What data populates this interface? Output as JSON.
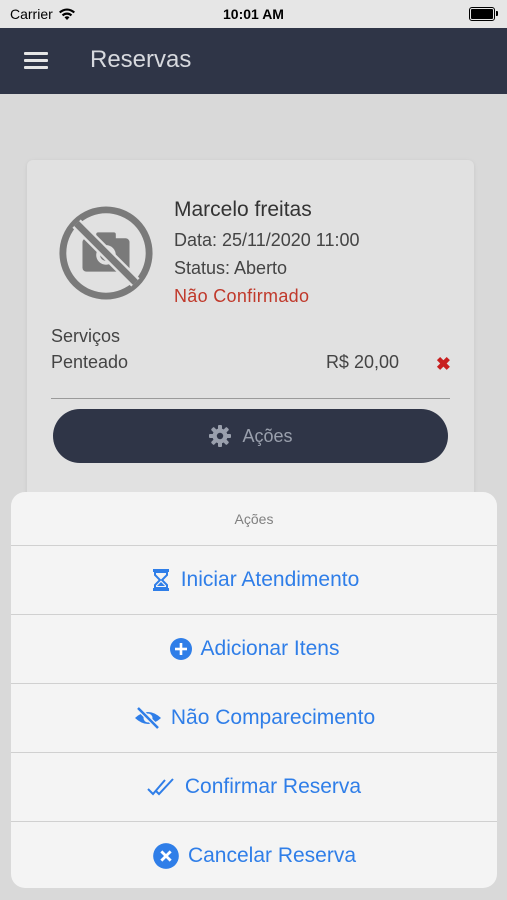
{
  "status_bar": {
    "carrier": "Carrier",
    "time": "10:01 AM"
  },
  "nav": {
    "title": "Reservas"
  },
  "card": {
    "name": "Marcelo freitas",
    "date": "Data: 25/11/2020 11:00",
    "status": "Status: Aberto",
    "confirmation": "Não Confirmado",
    "services_title": "Serviços",
    "services": [
      {
        "name": "Penteado",
        "price": "R$ 20,00"
      }
    ],
    "actions_button": "Ações"
  },
  "action_sheet": {
    "title": "Ações",
    "items": [
      {
        "label": "Iniciar Atendimento",
        "icon": "hourglass-icon"
      },
      {
        "label": "Adicionar Itens",
        "icon": "plus-circle-icon"
      },
      {
        "label": "Não Comparecimento",
        "icon": "eye-slash-icon"
      },
      {
        "label": "Confirmar Reserva",
        "icon": "double-check-icon"
      },
      {
        "label": "Cancelar Reserva",
        "icon": "x-circle-icon"
      }
    ]
  },
  "colors": {
    "accent": "#2f7ee8",
    "navbar": "#2f3547",
    "danger": "#c0392b"
  }
}
